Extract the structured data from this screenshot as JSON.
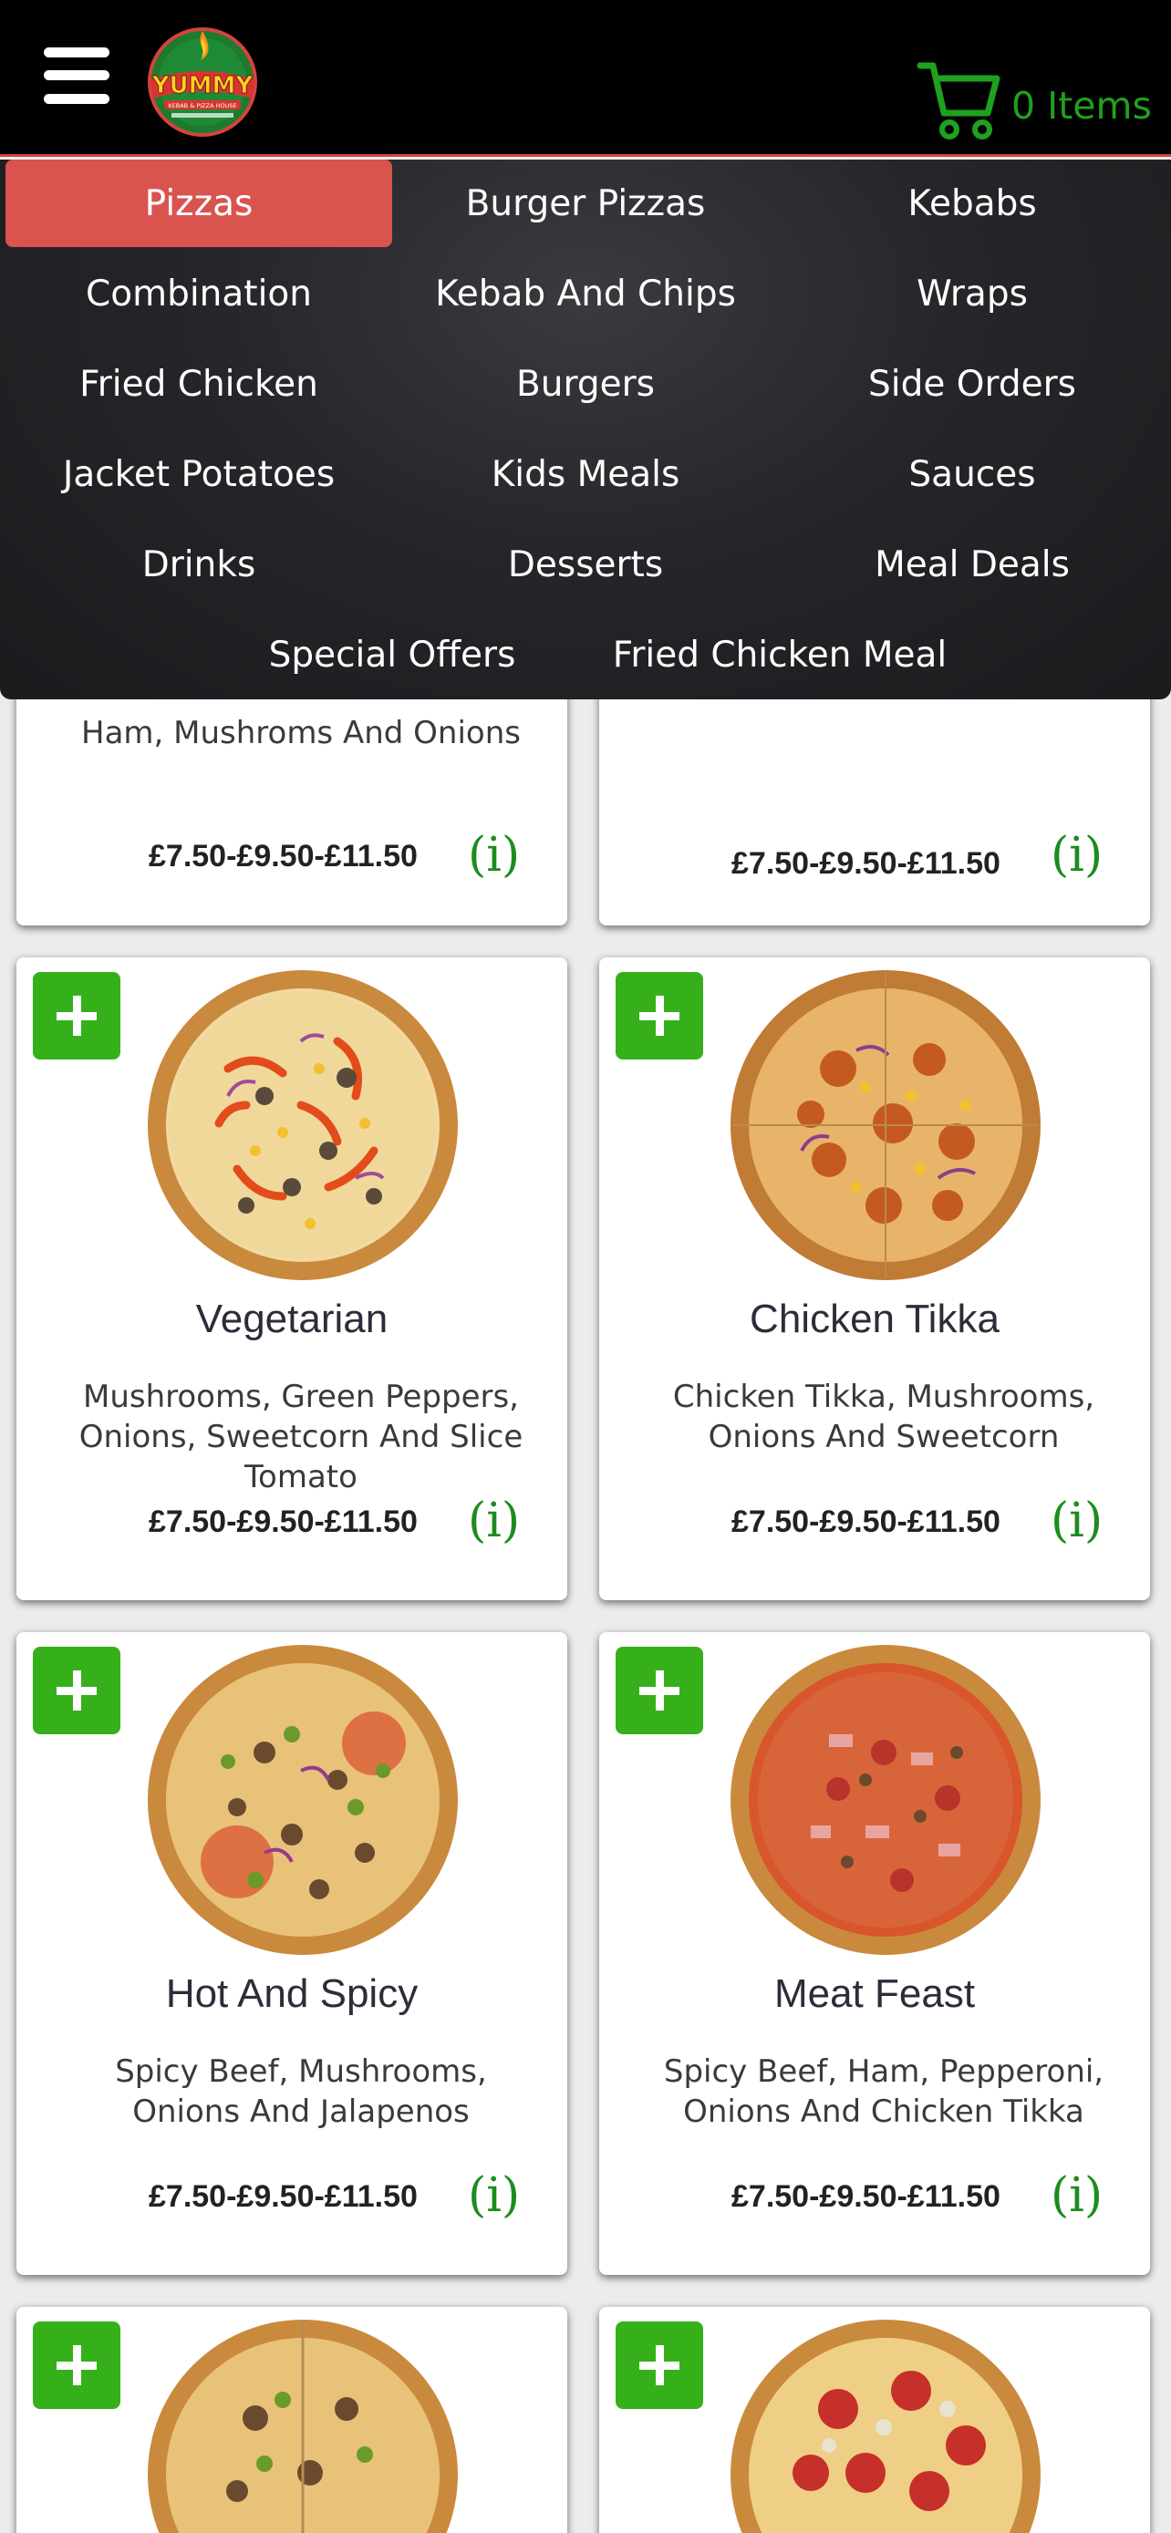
{
  "header": {
    "logo_text": "YUMMY",
    "logo_subtext": "KEBAB & PIZZA HOUSE",
    "cart_count": "0 Items"
  },
  "menu": {
    "items": [
      {
        "label": "Pizzas",
        "active": true
      },
      {
        "label": "Burger Pizzas"
      },
      {
        "label": "Kebabs"
      },
      {
        "label": "Combination"
      },
      {
        "label": "Kebab And Chips"
      },
      {
        "label": "Wraps"
      },
      {
        "label": "Fried Chicken"
      },
      {
        "label": "Burgers"
      },
      {
        "label": "Side Orders"
      },
      {
        "label": "Jacket Potatoes"
      },
      {
        "label": "Kids Meals"
      },
      {
        "label": "Sauces"
      },
      {
        "label": "Drinks"
      },
      {
        "label": "Desserts"
      },
      {
        "label": "Meal Deals"
      },
      {
        "label": "Special Offers"
      },
      {
        "label": "Fried Chicken Meal"
      }
    ]
  },
  "products": [
    {
      "name": "",
      "desc": "Ham, Mushroms And Onions",
      "price": "£7.50-£9.50-£11.50",
      "info": "(i)"
    },
    {
      "name": "",
      "desc": "",
      "price": "£7.50-£9.50-£11.50",
      "info": "(i)"
    },
    {
      "name": "Vegetarian",
      "desc": "Mushrooms, Green Peppers, Onions, Sweetcorn And Slice Tomato",
      "price": "£7.50-£9.50-£11.50",
      "info": "(i)"
    },
    {
      "name": "Chicken Tikka",
      "desc": "Chicken Tikka, Mushrooms, Onions And Sweetcorn",
      "price": "£7.50-£9.50-£11.50",
      "info": "(i)"
    },
    {
      "name": "Hot And Spicy",
      "desc": "Spicy Beef, Mushrooms, Onions And Jalapenos",
      "price": "£7.50-£9.50-£11.50",
      "info": "(i)"
    },
    {
      "name": "Meat Feast",
      "desc": "Spicy Beef, Ham, Pepperoni, Onions And Chicken Tikka",
      "price": "£7.50-£9.50-£11.50",
      "info": "(i)"
    }
  ],
  "colors": {
    "accent_red": "#d9534f",
    "cart_green": "#1fa11f",
    "add_green": "#35b01a",
    "info_green": "#1d8c1d"
  },
  "icons": {
    "menu": "hamburger-icon",
    "cart": "cart-icon",
    "add": "plus-icon",
    "info": "info-icon"
  }
}
